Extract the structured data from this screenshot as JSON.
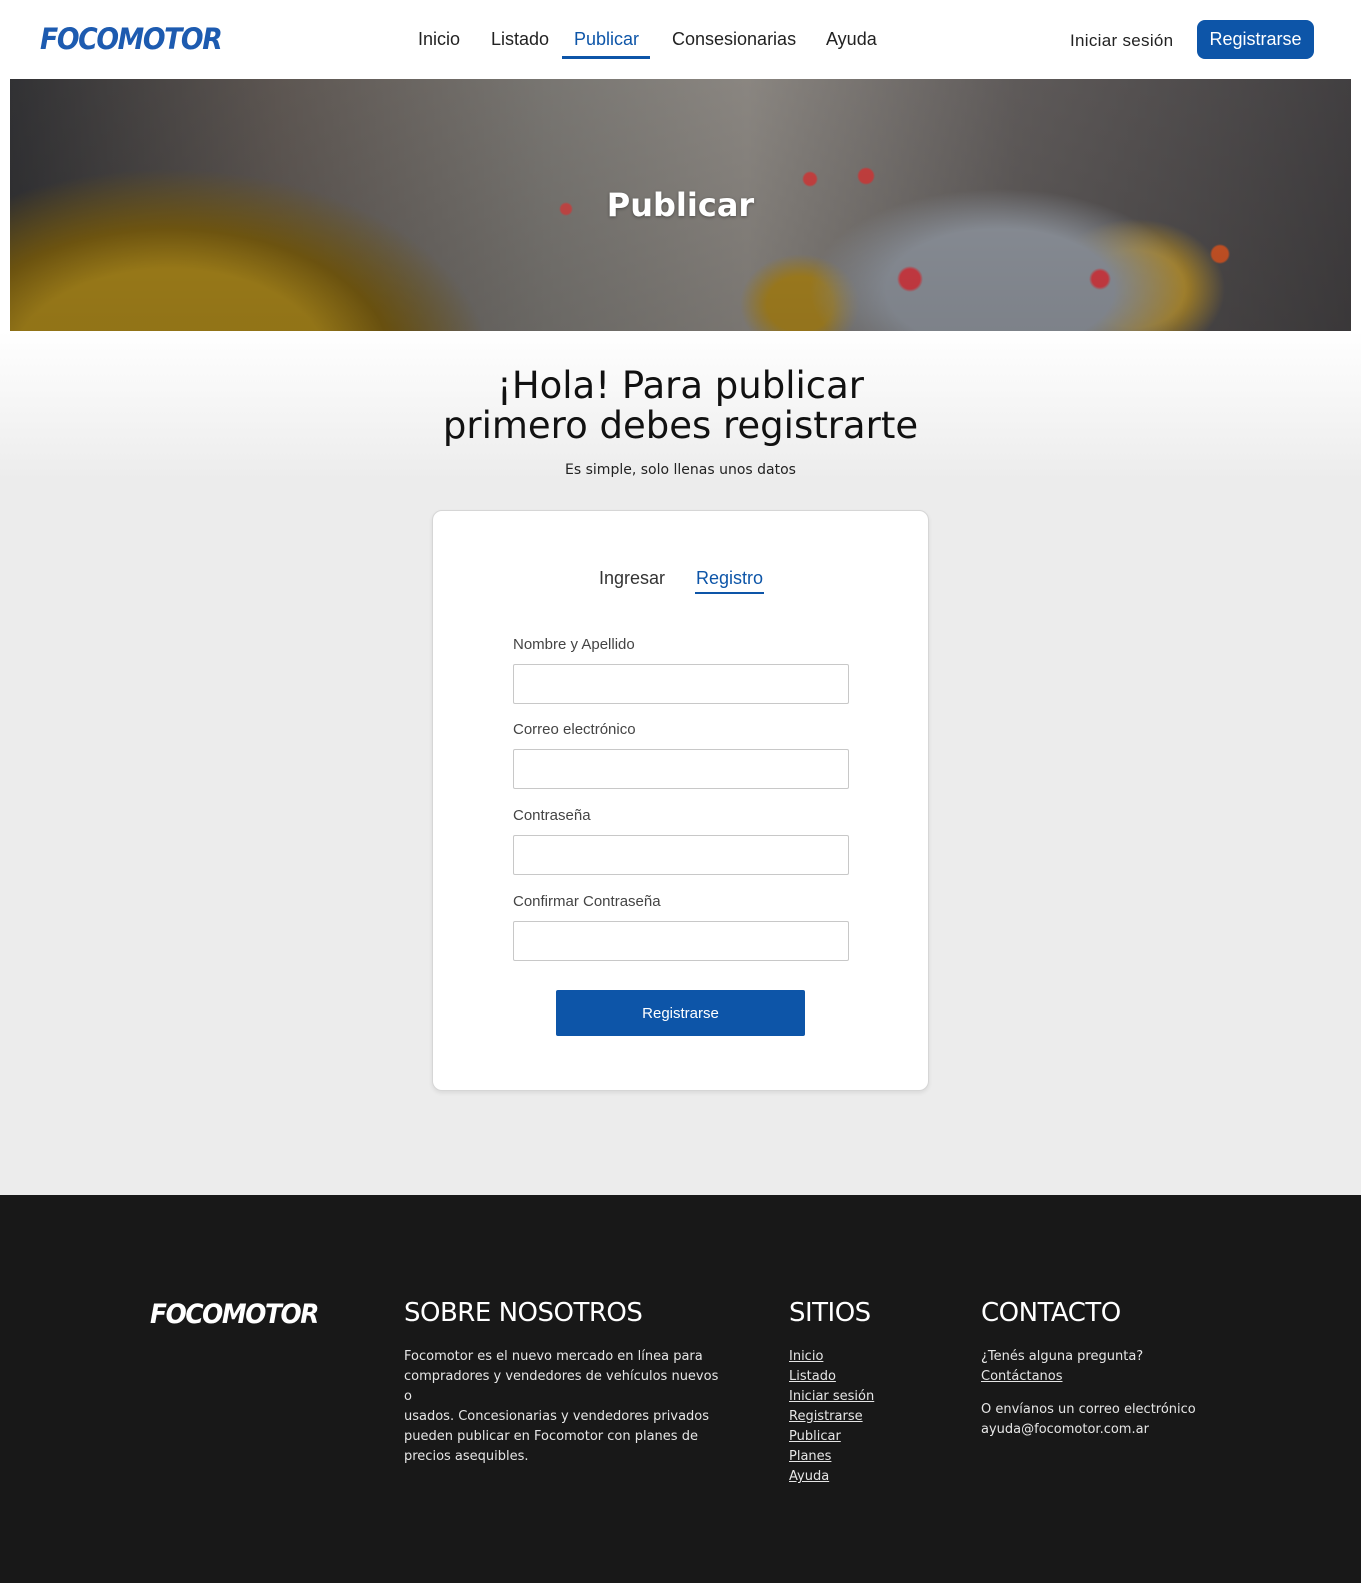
{
  "header": {
    "logo": "FOCOMOTOR",
    "nav": [
      "Inicio",
      "Listado",
      "Publicar",
      "Consesionarias",
      "Ayuda"
    ],
    "active_nav": "Publicar",
    "login_label": "Iniciar sesión",
    "register_label": "Registrarse"
  },
  "hero": {
    "title": "Publicar"
  },
  "main": {
    "headline_line1": "¡Hola! Para publicar",
    "headline_line2": "primero debes registrarte",
    "subline": "Es simple, solo llenas unos datos"
  },
  "form": {
    "tabs": [
      "Ingresar",
      "Registro"
    ],
    "active_tab": "Registro",
    "fields": [
      {
        "label": "Nombre y Apellido",
        "value": ""
      },
      {
        "label": "Correo electrónico",
        "value": ""
      },
      {
        "label": "Contraseña",
        "value": ""
      },
      {
        "label": "Confirmar Contraseña",
        "value": ""
      }
    ],
    "submit_label": "Registrarse"
  },
  "footer": {
    "logo": "FOCOMOTOR",
    "about": {
      "heading": "SOBRE NOSOTROS",
      "lines": [
        "Focomotor es el nuevo mercado en línea para",
        "compradores y vendedores de vehículos nuevos o",
        "usados. Concesionarias y vendedores privados",
        "pueden publicar en Focomotor con planes de",
        "precios asequibles."
      ]
    },
    "sites": {
      "heading": "SITIOS",
      "links": [
        "Inicio",
        "Listado",
        "Iniciar sesión",
        "Registrarse",
        "Publicar",
        "Planes",
        "Ayuda"
      ]
    },
    "contact": {
      "heading": "CONTACTO",
      "question": "¿Tenés alguna pregunta?",
      "contact_link": "Contáctanos",
      "email_prompt": "O envíanos un correo electrónico",
      "email": "ayuda@focomotor.com.ar"
    }
  },
  "colors": {
    "brand": "#0d55a8",
    "footer_bg": "#181818",
    "main_bg": "#ececec"
  }
}
